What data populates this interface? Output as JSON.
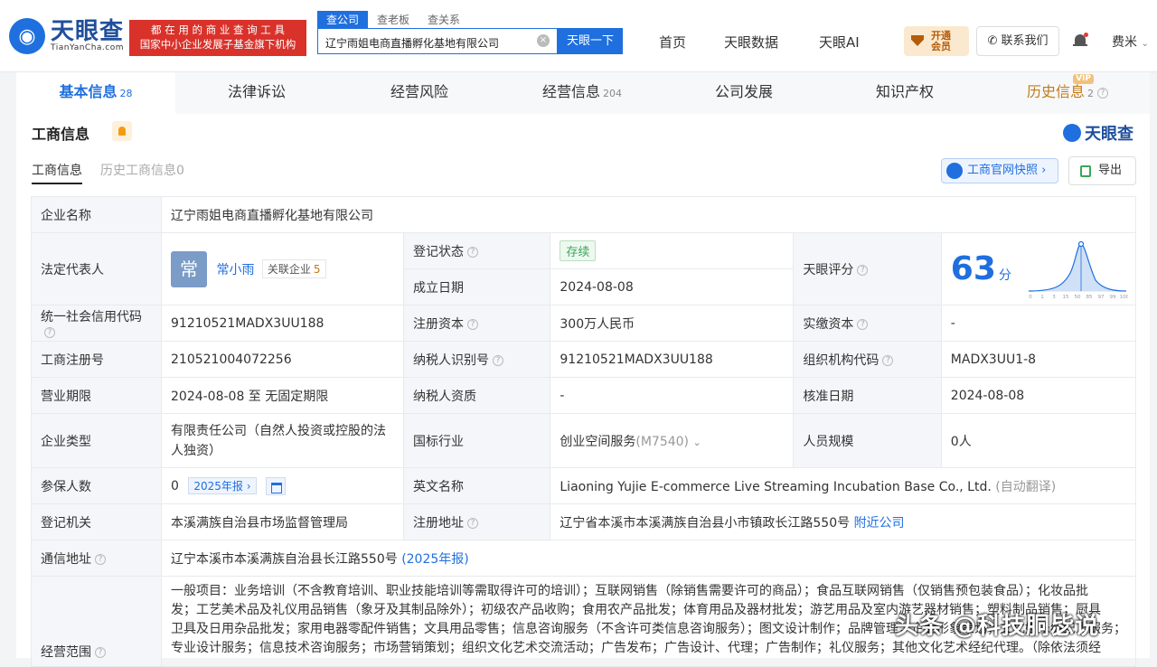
{
  "header": {
    "logo_cn": "天眼查",
    "logo_en": "TianYanCha.com",
    "slogan_line1": "都 在 用 的 商 业 查 询 工 具",
    "slogan_line2": "国家中小企业发展子基金旗下机构",
    "search_tabs": [
      "查公司",
      "查老板",
      "查关系"
    ],
    "search_value": "辽宁雨姐电商直播孵化基地有限公司",
    "search_button": "天眼一下",
    "nav": [
      "首页",
      "天眼数据",
      "天眼AI"
    ],
    "vip_line1": "开通",
    "vip_line2": "会员",
    "contact": "联系我们",
    "user": "费米"
  },
  "tabs": [
    {
      "label": "基本信息",
      "count": "28"
    },
    {
      "label": "法律诉讼",
      "count": ""
    },
    {
      "label": "经营风险",
      "count": ""
    },
    {
      "label": "经营信息",
      "count": "204"
    },
    {
      "label": "公司发展",
      "count": ""
    },
    {
      "label": "知识产权",
      "count": ""
    },
    {
      "label": "历史信息",
      "count": "2",
      "badge": "VIP"
    }
  ],
  "section": {
    "title": "工商信息",
    "brand": "天眼查",
    "subtab_current": "工商信息",
    "subtab_history": "历史工商信息0",
    "official_button": "工商官网快照",
    "export_button": "导出"
  },
  "info": {
    "company_name_label": "企业名称",
    "company_name": "辽宁雨姐电商直播孵化基地有限公司",
    "legal_rep_label": "法定代表人",
    "legal_rep_avatar": "常",
    "legal_rep_name": "常小雨",
    "related_label": "关联企业",
    "related_count": "5",
    "reg_status_label": "登记状态",
    "reg_status": "存续",
    "found_date_label": "成立日期",
    "found_date": "2024-08-08",
    "score_label": "天眼评分",
    "score": "63",
    "score_unit": "分",
    "credit_code_label": "统一社会信用代码",
    "credit_code": "91210521MADX3UU188",
    "reg_capital_label": "注册资本",
    "reg_capital": "300万人民币",
    "paid_capital_label": "实缴资本",
    "paid_capital": "-",
    "reg_no_label": "工商注册号",
    "reg_no": "210521004072256",
    "taxpayer_id_label": "纳税人识别号",
    "taxpayer_id": "91210521MADX3UU188",
    "org_code_label": "组织机构代码",
    "org_code": "MADX3UU1-8",
    "term_label": "营业期限",
    "term": "2024-08-08 至 无固定期限",
    "taxpayer_qual_label": "纳税人资质",
    "taxpayer_qual": "-",
    "approve_date_label": "核准日期",
    "approve_date": "2024-08-08",
    "company_type_label": "企业类型",
    "company_type": "有限责任公司（自然人投资或控股的法人独资）",
    "industry_label": "国标行业",
    "industry": "创业空间服务",
    "industry_code": "(M7540)",
    "staff_size_label": "人员规模",
    "staff_size": "0人",
    "insured_label": "参保人数",
    "insured": "0",
    "insured_year": "2025年报",
    "english_name_label": "英文名称",
    "english_name": "Liaoning Yujie E-commerce Live Streaming Incubation Base Co., Ltd.",
    "english_note": "(自动翻译)",
    "reg_authority_label": "登记机关",
    "reg_authority": "本溪满族自治县市场监督管理局",
    "reg_address_label": "注册地址",
    "reg_address": "辽宁省本溪市本溪满族自治县小市镇政长江路550号",
    "nearby": "附近公司",
    "mail_address_label": "通信地址",
    "mail_address": "辽宁本溪市本溪满族自治县长江路550号",
    "mail_address_year": "(2025年报)",
    "scope_label": "经营范围",
    "scope_line1": "一般项目：业务培训（不含教育培训、职业技能培训等需取得许可的培训）；互联网销售（除销售需要许可的商品）；食品互联网销售（仅销售预包装食品）；化妆品批",
    "scope_line2": "发；工艺美术品及礼仪用品销售（象牙及其制品除外）；初级农产品收购；食用农产品批发；体育用品及器材批发；游艺用品及室内游艺器材销售；塑料制品销售；厨具",
    "scope_line3": "卫具及日用杂品批发；家用电器零配件销售；文具用品零售；信息咨询服务（不含许可类信息咨询服务）；图文设计制作；品牌管理；企业形象策划；文化娱乐经纪人服务；",
    "scope_line4": "专业设计服务；信息技术咨询服务；市场营销策划；组织文化艺术交流活动；广告发布；广告设计、代理；广告制作；礼仪服务；其他文化艺术经纪代理。（除依法须经"
  },
  "score_chart": {
    "x_ticks": [
      "0",
      "1",
      "3",
      "15",
      "50",
      "85",
      "97",
      "99",
      "100"
    ]
  },
  "watermark": "头条 @科技胴毖说"
}
